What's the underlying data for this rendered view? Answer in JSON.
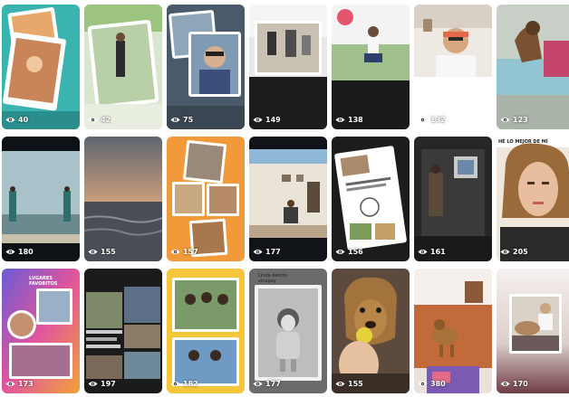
{
  "view_icon": "eye-icon",
  "colors": {
    "overlay_text": "#ffffff"
  },
  "tiles": [
    {
      "views": "40"
    },
    {
      "views": "42"
    },
    {
      "views": "75"
    },
    {
      "views": "149"
    },
    {
      "views": "138"
    },
    {
      "views": "132"
    },
    {
      "views": "123"
    },
    {
      "views": "180"
    },
    {
      "views": "155"
    },
    {
      "views": "157"
    },
    {
      "views": "177"
    },
    {
      "views": "156"
    },
    {
      "views": "161"
    },
    {
      "views": "205",
      "caption": "HÉ LO MEJOR DE MÍ"
    },
    {
      "views": "173",
      "caption": "LUGARES FAVORITOS"
    },
    {
      "views": "197"
    },
    {
      "views": "182"
    },
    {
      "views": "177",
      "caption": "Linda dentro vinapay"
    },
    {
      "views": "155"
    },
    {
      "views": "380"
    },
    {
      "views": "170"
    }
  ]
}
